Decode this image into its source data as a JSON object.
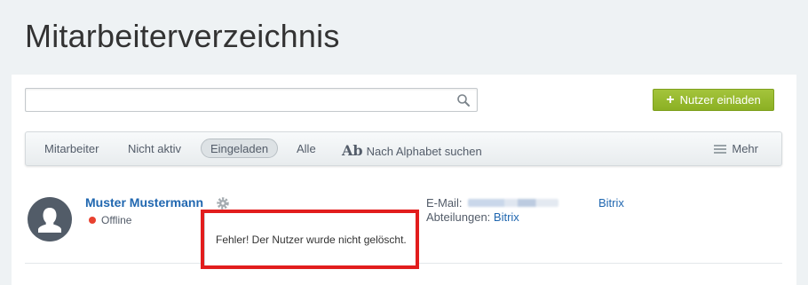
{
  "page": {
    "title": "Mitarbeiterverzeichnis"
  },
  "search": {
    "value": "",
    "placeholder": ""
  },
  "toolbar": {
    "invite_label": "Nutzer einladen"
  },
  "filters": {
    "tabs": [
      {
        "label": "Mitarbeiter",
        "active": false
      },
      {
        "label": "Nicht aktiv",
        "active": false
      },
      {
        "label": "Eingeladen",
        "active": true
      },
      {
        "label": "Alle",
        "active": false
      }
    ],
    "alphabet_icon": "Ab",
    "alphabet_label": "Nach Alphabet suchen",
    "more_label": "Mehr"
  },
  "employee": {
    "name": "Muster Mustermann",
    "status": "Offline",
    "email_label": "E-Mail:",
    "department_label": "Abteilungen:",
    "department": "Bitrix",
    "company": "Bitrix"
  },
  "popup": {
    "message": "Fehler! Der Nutzer wurde nicht gelöscht."
  },
  "colors": {
    "accent_green": "#8bb023",
    "link_blue": "#2067b0",
    "status_offline": "#e8412f",
    "highlight_red": "#e21d1d"
  }
}
